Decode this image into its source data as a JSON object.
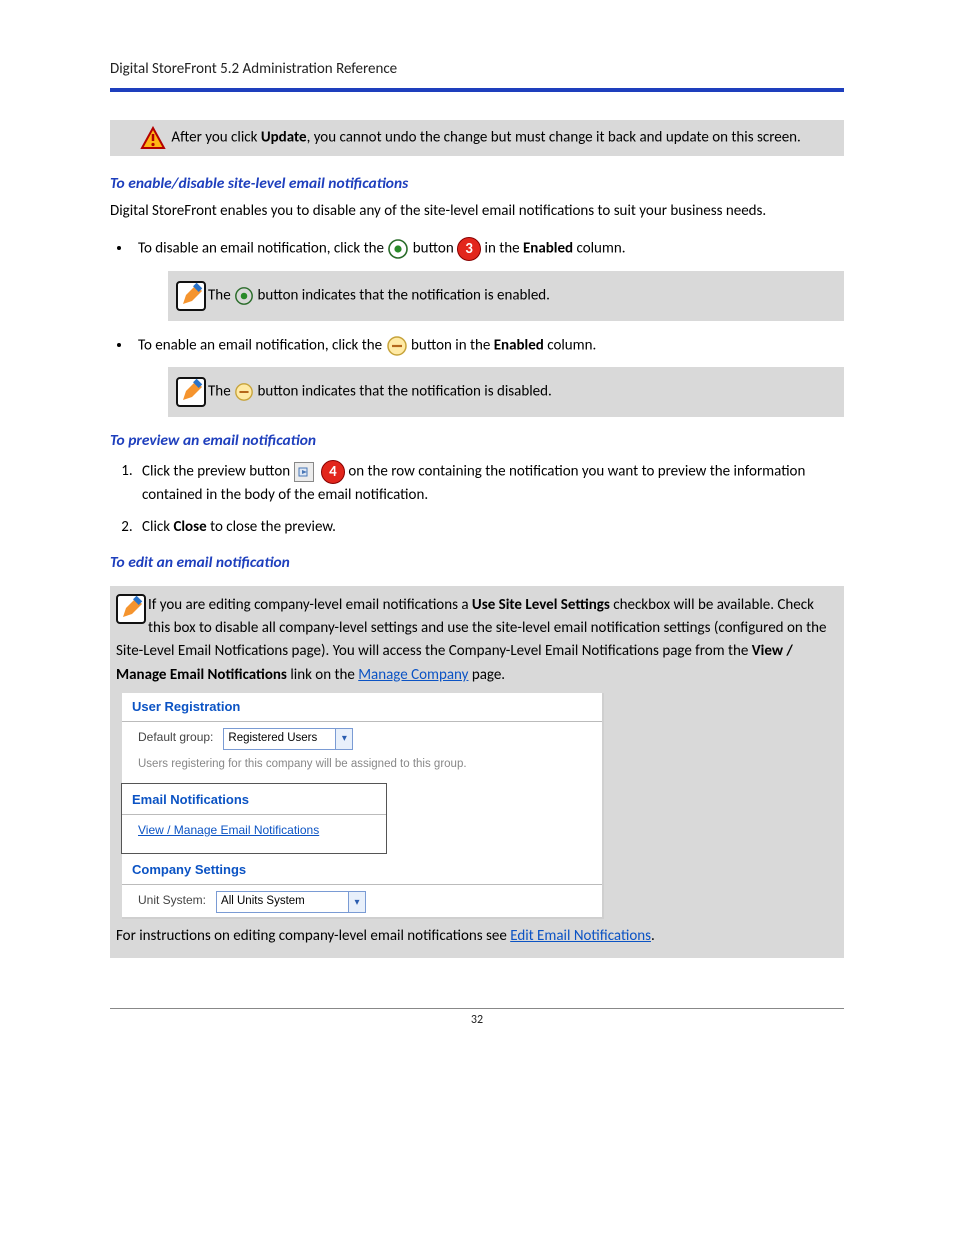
{
  "header": {
    "title": "Digital StoreFront 5.2 Administration Reference"
  },
  "callout1": {
    "pre": "After you click ",
    "bold": "Update",
    "post": ", you cannot undo the change but must change it back and update on this screen."
  },
  "sec1": {
    "heading": "To enable/disable site-level email notifications",
    "intro": "Digital StoreFront enables you to disable any of the site-level email notifications to suit your business needs.",
    "disable_pre": "To disable an email notification, click the ",
    "disable_mid": " button ",
    "disable_post_pre": " in the ",
    "disable_bold": "Enabled",
    "disable_post": " column.",
    "note_enabled_pre": "The ",
    "note_enabled_post": " button indicates that the notification is enabled.",
    "enable_pre": "To enable an email notification, click the ",
    "enable_mid": " button in the ",
    "enable_bold": "Enabled",
    "enable_post": " column.",
    "note_disabled_pre": "The ",
    "note_disabled_post": " button indicates that the notification is disabled."
  },
  "sec2": {
    "heading": "To preview an email notification",
    "step1_pre": "Click the preview button ",
    "step1_post": " on the row containing the notification you want to preview the information contained in the body of the email notification.",
    "step2_pre": "Click ",
    "step2_bold": "Close",
    "step2_post": " to close the preview."
  },
  "sec3": {
    "heading": "To edit an email notification",
    "para_pre": "If you are editing company-level email notifications a ",
    "para_bold1": "Use Site Level Settings",
    "para_mid": " checkbox will be available. Check this box to disable all company-level settings and use the site-level email notification settings (configured on the Site-Level Email Notfications page). You will access the Company-Level Email Notifications page from the ",
    "para_bold2": "View / Manage Email Notifications",
    "para_mid2": " link on the ",
    "link1": "Manage Company",
    "para_post": " page.",
    "bottom_pre": "For instructions on editing company-level email notifications see ",
    "bottom_link": "Edit Email Notifications",
    "bottom_post": "."
  },
  "screenshot": {
    "user_reg": {
      "title": "User Registration",
      "label": "Default group:",
      "select": "Registered Users",
      "hint": "Users registering for this company will be assigned to this group."
    },
    "email_notif": {
      "title": "Email Notifications",
      "link": "View / Manage Email Notifications"
    },
    "company": {
      "title": "Company Settings",
      "label": "Unit System:",
      "select": "All Units System"
    }
  },
  "badges": {
    "three": "3",
    "four": "4"
  },
  "footer": {
    "page": "32"
  }
}
